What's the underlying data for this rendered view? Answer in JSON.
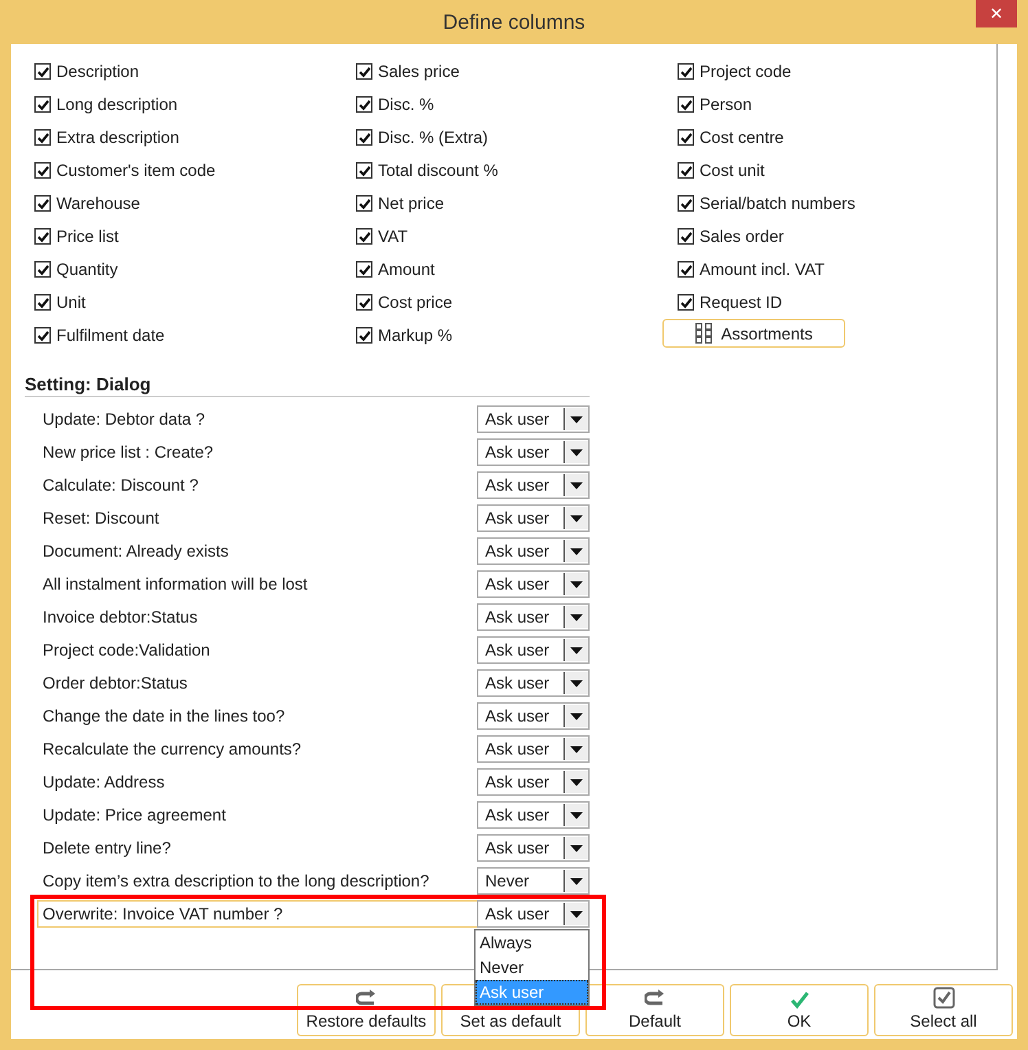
{
  "window": {
    "title": "Define columns",
    "close": "✕"
  },
  "columns": [
    {
      "label": "Description",
      "checked": true
    },
    {
      "label": "Sales price",
      "checked": true
    },
    {
      "label": "Project code",
      "checked": true
    },
    {
      "label": "Long description",
      "checked": true
    },
    {
      "label": "Disc. %",
      "checked": true
    },
    {
      "label": "Person",
      "checked": true
    },
    {
      "label": "Extra description",
      "checked": true
    },
    {
      "label": "Disc. % (Extra)",
      "checked": true
    },
    {
      "label": "Cost centre",
      "checked": true
    },
    {
      "label": "Customer's item code",
      "checked": true
    },
    {
      "label": "Total discount %",
      "checked": true
    },
    {
      "label": "Cost unit",
      "checked": true
    },
    {
      "label": "Warehouse",
      "checked": true
    },
    {
      "label": "Net price",
      "checked": true
    },
    {
      "label": "Serial/batch numbers",
      "checked": true
    },
    {
      "label": "Price list",
      "checked": true
    },
    {
      "label": "VAT",
      "checked": true
    },
    {
      "label": "Sales order",
      "checked": true
    },
    {
      "label": "Quantity",
      "checked": true
    },
    {
      "label": "Amount",
      "checked": true
    },
    {
      "label": "Amount incl. VAT",
      "checked": true
    },
    {
      "label": "Unit",
      "checked": true
    },
    {
      "label": "Cost price",
      "checked": true
    },
    {
      "label": "Request ID",
      "checked": true
    },
    {
      "label": "Fulfilment date",
      "checked": true
    },
    {
      "label": "Markup %",
      "checked": true
    }
  ],
  "assortments_button": {
    "label": "Assortments"
  },
  "settings": {
    "title": "Setting: Dialog",
    "rows": [
      {
        "label": "Update: Debtor data ?",
        "value": "Ask user"
      },
      {
        "label": "New price list : Create?",
        "value": "Ask user"
      },
      {
        "label": "Calculate: Discount ?",
        "value": "Ask user"
      },
      {
        "label": "Reset: Discount",
        "value": "Ask user"
      },
      {
        "label": "Document: Already exists",
        "value": "Ask user"
      },
      {
        "label": "All instalment information will be lost",
        "value": "Ask user"
      },
      {
        "label": "Invoice debtor:Status",
        "value": "Ask user"
      },
      {
        "label": "Project code:Validation",
        "value": "Ask user"
      },
      {
        "label": "Order debtor:Status",
        "value": "Ask user"
      },
      {
        "label": "Change the date in the lines too?",
        "value": "Ask user"
      },
      {
        "label": "Recalculate the currency amounts?",
        "value": "Ask user"
      },
      {
        "label": "Update: Address",
        "value": "Ask user"
      },
      {
        "label": "Update: Price agreement",
        "value": "Ask user"
      },
      {
        "label": "Delete entry line?",
        "value": "Ask user"
      },
      {
        "label": "Copy item’s extra description to the long description?",
        "value": "Never"
      },
      {
        "label": "Overwrite: Invoice VAT number ?",
        "value": "Ask user",
        "focused": true,
        "highlighted": true,
        "open": true,
        "options": [
          {
            "label": "Always",
            "selected": false
          },
          {
            "label": "Never",
            "selected": false
          },
          {
            "label": "Ask user",
            "selected": true
          }
        ]
      }
    ]
  },
  "buttons": [
    {
      "label": "Restore defaults",
      "kind": "redo"
    },
    {
      "label": "Set as default",
      "kind": "plain"
    },
    {
      "label": "Default",
      "kind": "redo"
    },
    {
      "label": "OK",
      "kind": "check"
    },
    {
      "label": "Select all",
      "kind": "checkbox"
    }
  ]
}
